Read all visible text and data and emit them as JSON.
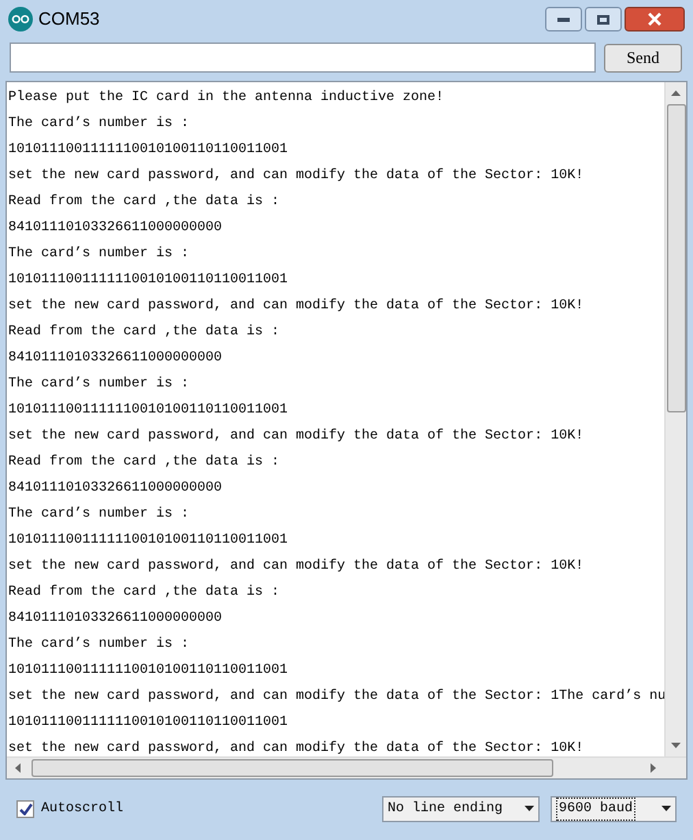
{
  "window": {
    "title": "COM53"
  },
  "send_button": "Send",
  "output_lines": [
    "Please put the IC card in the antenna inductive zone!",
    "The card’s number is  :",
    "1010111001111110010100110110011001",
    "set the new card password, and can modify the data of the Sector: 10K!",
    "Read from the card ,the data is :",
    "84101110103326611000000000",
    "The card’s number is  :",
    "1010111001111110010100110110011001",
    "set the new card password, and can modify the data of the Sector: 10K!",
    "Read from the card ,the data is :",
    "84101110103326611000000000",
    "The card’s number is  :",
    "1010111001111110010100110110011001",
    "set the new card password, and can modify the data of the Sector: 10K!",
    "Read from the card ,the data is :",
    "84101110103326611000000000",
    "The card’s number is  :",
    "1010111001111110010100110110011001",
    "set the new card password, and can modify the data of the Sector: 10K!",
    "Read from the card ,the data is :",
    "84101110103326611000000000",
    "The card’s number is  :",
    "1010111001111110010100110110011001",
    "set the new card password, and can modify the data of the Sector: 1The card’s nu",
    "1010111001111110010100110110011001",
    "set the new card password, and can modify the data of the Sector: 10K!"
  ],
  "autoscroll": {
    "label": "Autoscroll",
    "checked": true
  },
  "line_ending": "No line ending",
  "baud": "9600 baud"
}
